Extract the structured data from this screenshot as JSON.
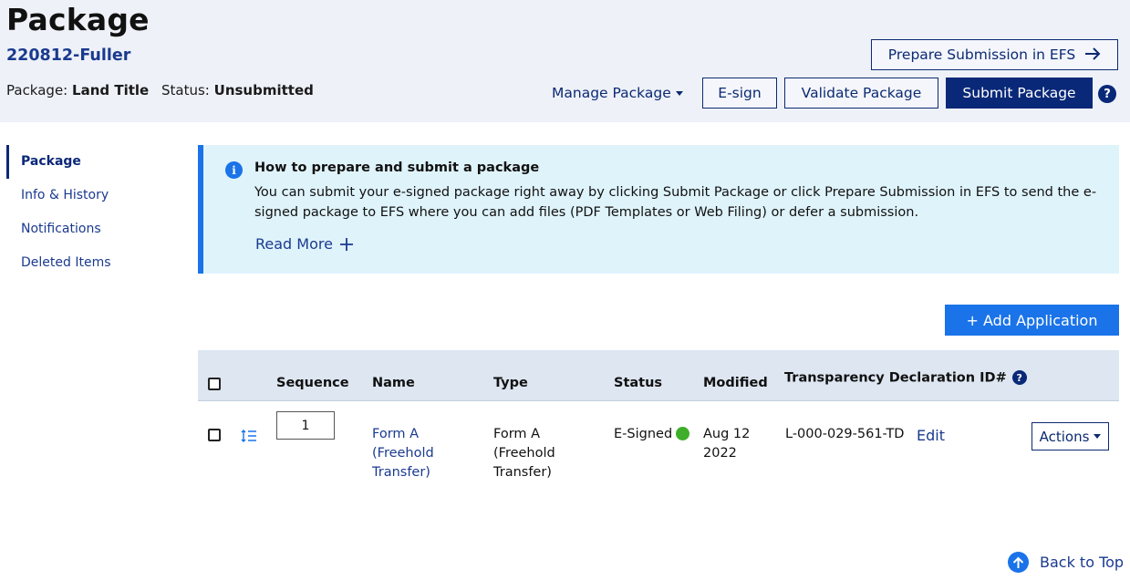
{
  "header": {
    "title": "Package",
    "package_id": "220812-Fuller",
    "package_label": "Package:",
    "package_value": "Land Title",
    "status_label": "Status:",
    "status_value": "Unsubmitted",
    "prepare_button": "Prepare Submission in EFS",
    "manage_package": "Manage Package",
    "esign_button": "E-sign",
    "validate_button": "Validate Package",
    "submit_button": "Submit Package",
    "help_glyph": "?"
  },
  "sidebar": {
    "items": [
      {
        "label": "Package",
        "active": true
      },
      {
        "label": "Info & History",
        "active": false
      },
      {
        "label": "Notifications",
        "active": false
      },
      {
        "label": "Deleted Items",
        "active": false
      }
    ]
  },
  "callout": {
    "icon": "i",
    "title": "How to prepare and submit a package",
    "body": "You can submit your e-signed package right away by clicking Submit Package or click Prepare Submission in EFS to send the e-signed package to EFS where you can add files (PDF Templates or Web Filing) or defer a submission.",
    "read_more": "Read More"
  },
  "add_application_button": "+ Add Application",
  "table": {
    "columns": {
      "sequence": "Sequence",
      "name": "Name",
      "type": "Type",
      "status": "Status",
      "modified": "Modified",
      "transparency": "Transparency Declaration ID#"
    },
    "rows": [
      {
        "sequence": "1",
        "name_line1": "Form A",
        "name_line2": "(Freehold",
        "name_line3": "Transfer)",
        "type_line1": "Form A",
        "type_line2": "(Freehold",
        "type_line3": "Transfer)",
        "status": "E-Signed",
        "modified_line1": "Aug 12",
        "modified_line2": "2022",
        "transparency_id": "L-000-029-561-TD",
        "edit_link": "Edit",
        "actions_button": "Actions"
      }
    ]
  },
  "back_to_top": "Back to Top",
  "colors": {
    "header_bg": "#eef1f8",
    "primary": "#0a2878",
    "accent": "#1a73e8",
    "callout_bg": "#dff3fb",
    "signed_green": "#3fae2a"
  }
}
